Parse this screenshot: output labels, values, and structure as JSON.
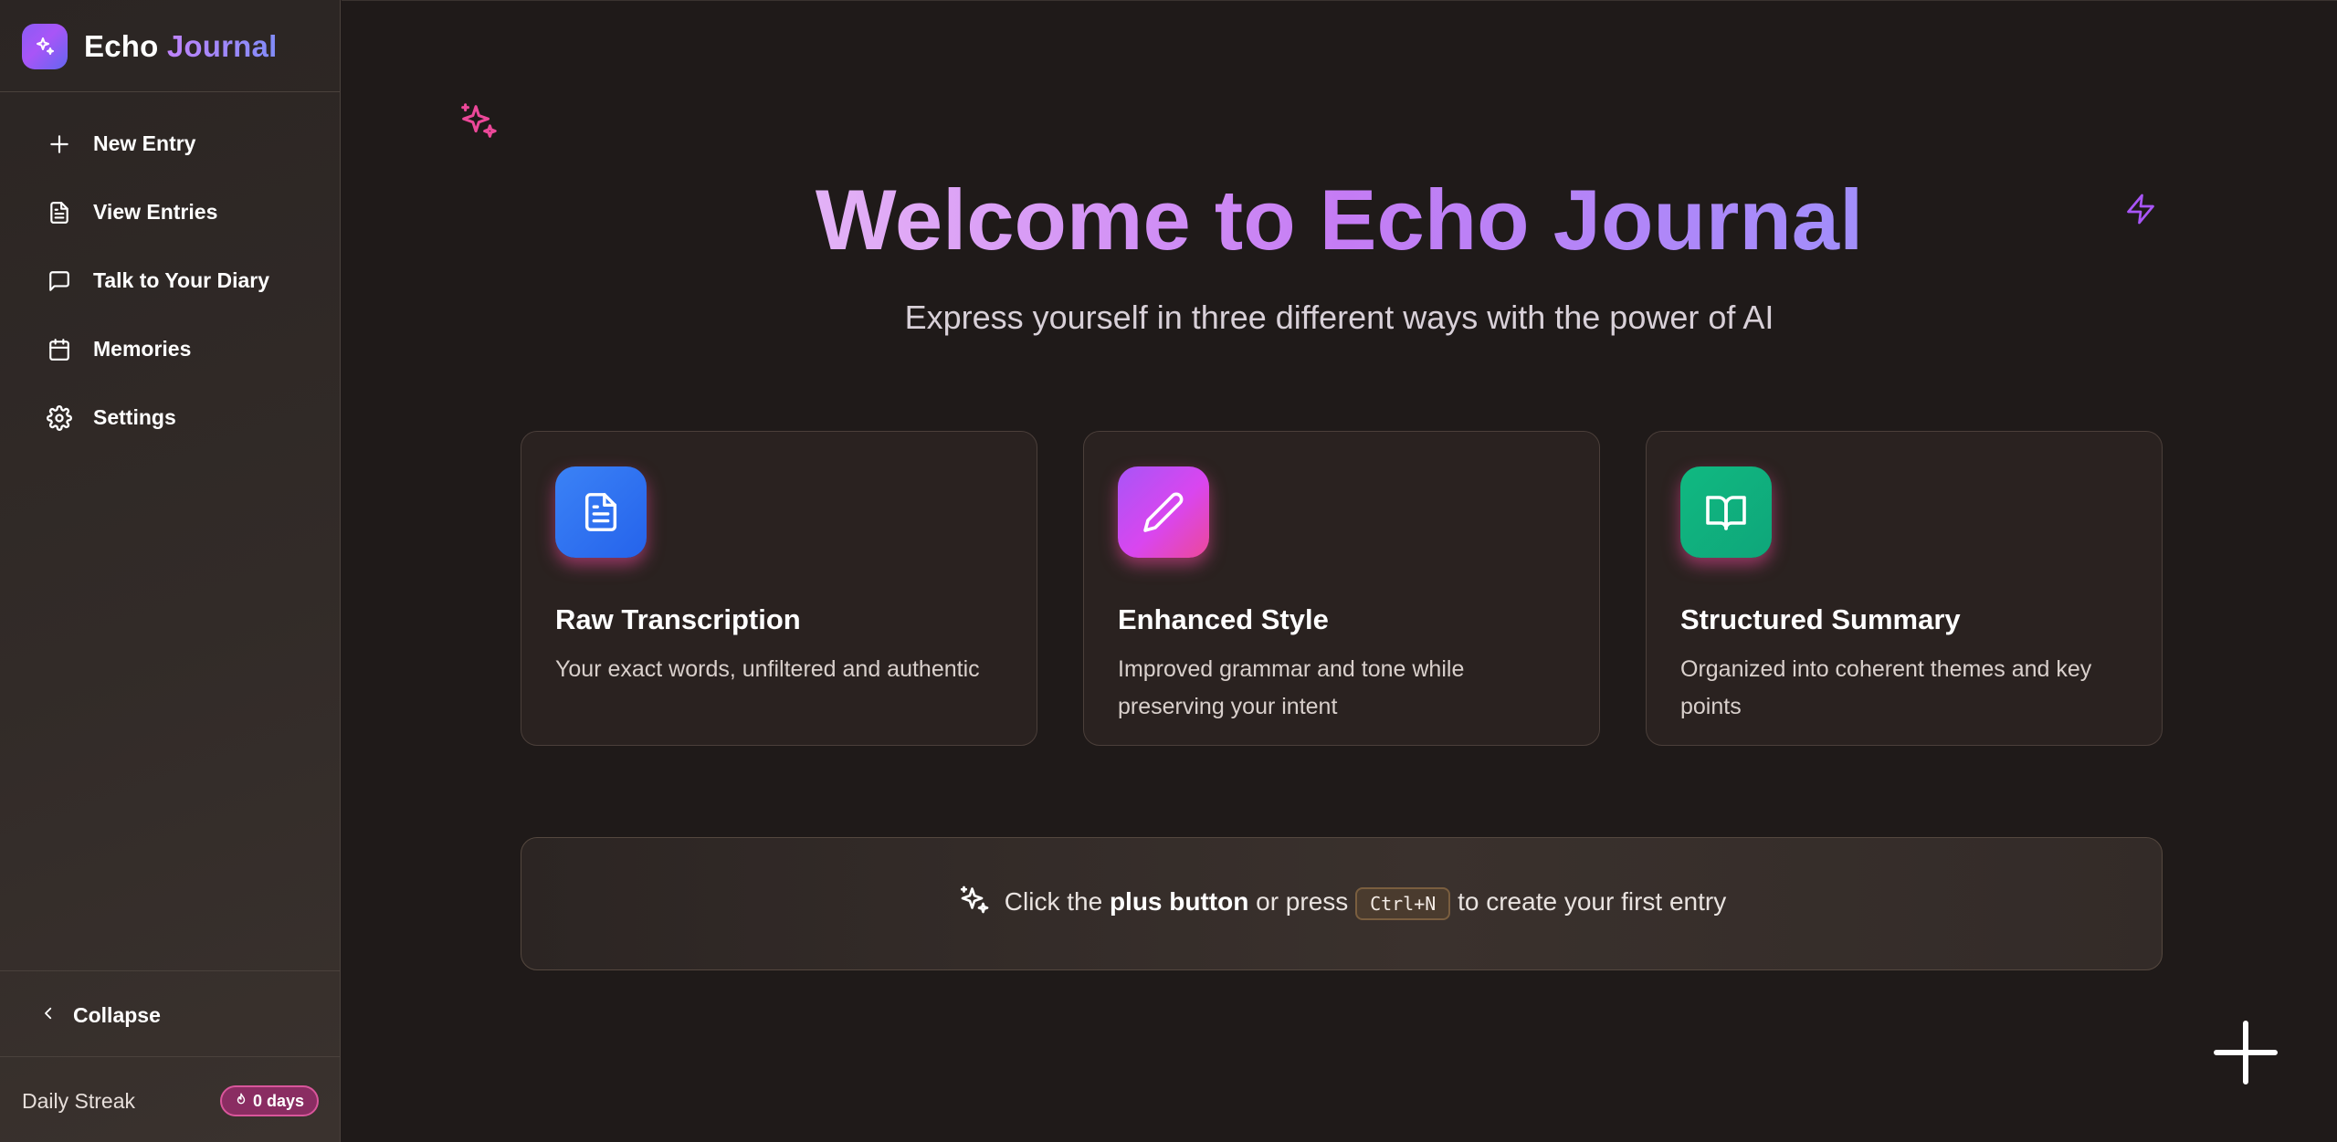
{
  "app": {
    "name_part1": "Echo",
    "name_part2": "Journal"
  },
  "sidebar": {
    "items": [
      {
        "label": "New Entry",
        "icon": "plus-icon"
      },
      {
        "label": "View Entries",
        "icon": "file-text-icon"
      },
      {
        "label": "Talk to Your Diary",
        "icon": "message-square-icon"
      },
      {
        "label": "Memories",
        "icon": "calendar-icon"
      },
      {
        "label": "Settings",
        "icon": "gear-icon"
      }
    ],
    "collapse_label": "Collapse",
    "streak_label": "Daily Streak",
    "streak_value": "0 days"
  },
  "hero": {
    "title": "Welcome to Echo Journal",
    "subtitle": "Express yourself in three different ways with the power of AI"
  },
  "cards": [
    {
      "title": "Raw Transcription",
      "description": "Your exact words, unfiltered and authentic",
      "icon": "document-icon",
      "color": "#3b82f6"
    },
    {
      "title": "Enhanced Style",
      "description": "Improved grammar and tone while preserving your intent",
      "icon": "pencil-icon",
      "color": "#d946ef"
    },
    {
      "title": "Structured Summary",
      "description": "Organized into coherent themes and key points",
      "icon": "book-open-icon",
      "color": "#10b981"
    }
  ],
  "hint": {
    "prefix": "Click the",
    "bold": "plus button",
    "middle": "or press",
    "shortcut": "Ctrl+N",
    "suffix": "to create your first entry"
  },
  "colors": {
    "accent_purple": "#a855f7",
    "accent_pink": "#ec4899",
    "background": "#1f1a19"
  }
}
